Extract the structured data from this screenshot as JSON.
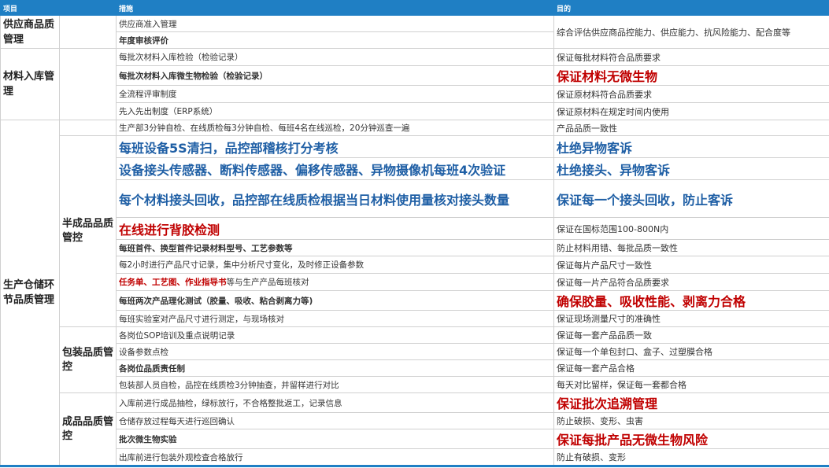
{
  "header": {
    "col1": "项目",
    "col2": "措施",
    "col3": "目的"
  },
  "cat1": {
    "supply": "供应商品质管理",
    "material": "材料入库管理",
    "production": "生产仓储环节品质管理"
  },
  "cat2": {
    "semi": "半成品品质管控",
    "pack": "包装品质管控",
    "finished": "成品品质管控"
  },
  "rows": [
    {
      "m": "供应商准入管理",
      "p": "综合评估供应商品控能力、供应能力、抗风险能力、配合度等"
    },
    {
      "m": "年度审核评价"
    },
    {
      "m": "每批次材料入库检验（检验记录）",
      "p": "保证每批材料符合品质要求"
    },
    {
      "m": "每批次材料入库微生物检验（检验记录）",
      "p": "保证材料无微生物"
    },
    {
      "m": "全流程评审制度",
      "p": "保证原材料符合品质要求"
    },
    {
      "m": "先入先出制度（ERP系统）",
      "p": "保证原材料在规定时间内使用"
    },
    {
      "m": "生产部3分钟自检、在线质检每3分钟自检、每班4名在线巡检，20分钟巡查一遍",
      "p": "产品品质一致性"
    },
    {
      "m": "每班设备5S清扫，品控部稽核打分考核",
      "p": "杜绝异物客诉"
    },
    {
      "m": "设备接头传感器、断料传感器、偏移传感器、异物摄像机每班4次验证",
      "p": "杜绝接头、异物客诉"
    },
    {
      "m": "每个材料接头回收，品控部在线质检根据当日材料使用量核对接头数量",
      "p": "保证每一个接头回收，防止客诉"
    },
    {
      "m": "在线进行背胶检测",
      "p": "保证在国标范围100-800N内"
    },
    {
      "m": "每班首件、换型首件记录材料型号、工艺参数等",
      "p": "防止材料用错、每批品质一致性"
    },
    {
      "m": "每2小时进行产品尺寸记录，集中分析尺寸变化，及时修正设备参数",
      "p": "保证每片产品尺寸一致性"
    },
    {
      "m": "任务单、工艺图、作业指导书",
      "m2": "等与生产产品每班核对",
      "p": "保证每一片产品符合品质要求"
    },
    {
      "m": "每班两次产品理化测试（胶量、吸收、粘合剥离力等)",
      "p": "确保胶量、吸收性能、剥离力合格"
    },
    {
      "m": "每班实验室对产品尺寸进行测定，与现场核对",
      "p": "保证现场测量尺寸的准确性"
    },
    {
      "m": "各岗位SOP培训及重点说明记录",
      "p": "保证每一套产品品质一致"
    },
    {
      "m": "设备参数点检",
      "p": "保证每一个单包封口、盒子、过塑膜合格"
    },
    {
      "m": "各岗位品质责任制",
      "p": "保证每一套产品合格"
    },
    {
      "m": "包装部人员自检，品控在线质检3分钟抽查，并留样进行对比",
      "p": "每天对比留样，保证每一套都合格"
    },
    {
      "m": "入库前进行成品抽检，绿标放行，不合格整批返工，记录信息",
      "p": "保证批次追溯管理"
    },
    {
      "m": "仓储存放过程每天进行巡回确认",
      "p": "防止破损、变形、虫害"
    },
    {
      "m": "批次微生物实验",
      "p": "保证每批产品无微生物风险"
    },
    {
      "m": "出库前进行包装外观检查合格放行",
      "p": "防止有破损、变形"
    }
  ]
}
